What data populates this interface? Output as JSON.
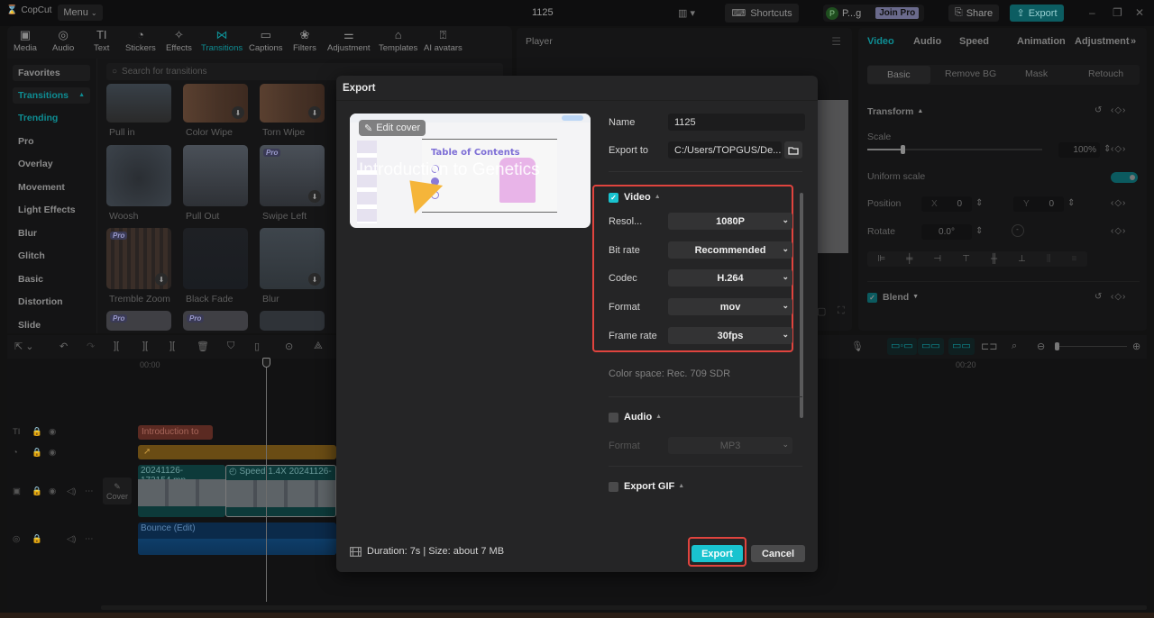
{
  "app": {
    "name": "CopCut",
    "menu_label": "Menu",
    "project_title": "1125",
    "shortcuts_label": "Shortcuts",
    "user_initial": "P",
    "user_name": "P...g",
    "join_pro_label": "Join Pro",
    "share_label": "Share",
    "export_label": "Export",
    "accent_color": "#19c3cf",
    "highlight_color": "#e0443e"
  },
  "toolbar": {
    "items": [
      {
        "label": "Media",
        "icon": "media-icon"
      },
      {
        "label": "Audio",
        "icon": "audio-icon"
      },
      {
        "label": "Text",
        "icon": "text-icon"
      },
      {
        "label": "Stickers",
        "icon": "stickers-icon"
      },
      {
        "label": "Effects",
        "icon": "effects-icon"
      },
      {
        "label": "Transitions",
        "icon": "transitions-icon",
        "active": true
      },
      {
        "label": "Captions",
        "icon": "captions-icon"
      },
      {
        "label": "Filters",
        "icon": "filters-icon"
      },
      {
        "label": "Adjustment",
        "icon": "adjustment-icon"
      },
      {
        "label": "Templates",
        "icon": "templates-icon"
      },
      {
        "label": "AI avatars",
        "icon": "ai-avatars-icon"
      }
    ]
  },
  "sidebar": {
    "items": [
      {
        "label": "Favorites"
      },
      {
        "label": "Transitions"
      },
      {
        "label": "Trending"
      },
      {
        "label": "Pro"
      },
      {
        "label": "Overlay"
      },
      {
        "label": "Movement"
      },
      {
        "label": "Light Effects"
      },
      {
        "label": "Blur"
      },
      {
        "label": "Glitch"
      },
      {
        "label": "Basic"
      },
      {
        "label": "Distortion"
      },
      {
        "label": "Slide"
      }
    ]
  },
  "transitions": {
    "search_placeholder": "Search for transitions",
    "pro_badge": "Pro",
    "items": [
      {
        "label": "Pull in"
      },
      {
        "label": "Color Wipe"
      },
      {
        "label": "Torn Wipe"
      },
      {
        "label": "Woosh"
      },
      {
        "label": "Pull Out"
      },
      {
        "label": "Swipe Left"
      },
      {
        "label": "Tremble Zoom"
      },
      {
        "label": "Black Fade"
      },
      {
        "label": "Blur"
      }
    ]
  },
  "player": {
    "title": "Player"
  },
  "inspector": {
    "tabs": [
      "Video",
      "Audio",
      "Speed",
      "Animation",
      "Adjustment"
    ],
    "subtabs": [
      "Basic",
      "Remove BG",
      "Mask",
      "Retouch"
    ],
    "transform_label": "Transform",
    "scale_label": "Scale",
    "scale_value": "100%",
    "scale_fraction": 0.2,
    "uniform_scale_label": "Uniform scale",
    "position_label": "Position",
    "x_label": "X",
    "x_value": "0",
    "y_label": "Y",
    "y_value": "0",
    "rotate_label": "Rotate",
    "rotate_value": "0.0°",
    "blend_label": "Blend"
  },
  "timeline": {
    "ruler_start": "00:00",
    "ruler_mark": "00:20",
    "text_clip": "Introduction to Ge",
    "video_clip_1": "20241126-173154.mp",
    "video_clip_2_speed": "Speed 1.4X",
    "video_clip_2_name": "20241126-",
    "audio_clip": "Bounce (Edit)",
    "cover_label": "Cover"
  },
  "export_dialog": {
    "title": "Export",
    "edit_cover_label": "Edit cover",
    "preview_overlay_text": "Introduction to Genetics",
    "preview_slide_title": "Table of Contents",
    "name_label": "Name",
    "name_value": "1125",
    "export_to_label": "Export to",
    "export_to_value": "C:/Users/TOPGUS/De...",
    "video": {
      "label": "Video",
      "checked": true,
      "resolution_label": "Resol...",
      "resolution_value": "1080P",
      "bitrate_label": "Bit rate",
      "bitrate_value": "Recommended",
      "codec_label": "Codec",
      "codec_value": "H.264",
      "format_label": "Format",
      "format_value": "mov",
      "framerate_label": "Frame rate",
      "framerate_value": "30fps",
      "color_space": "Color space: Rec. 709 SDR"
    },
    "audio": {
      "label": "Audio",
      "checked": false,
      "format_label": "Format",
      "format_value": "MP3"
    },
    "gif": {
      "label": "Export GIF",
      "checked": false
    },
    "footer_info": "Duration: 7s | Size: about 7 MB",
    "export_button": "Export",
    "cancel_button": "Cancel"
  }
}
